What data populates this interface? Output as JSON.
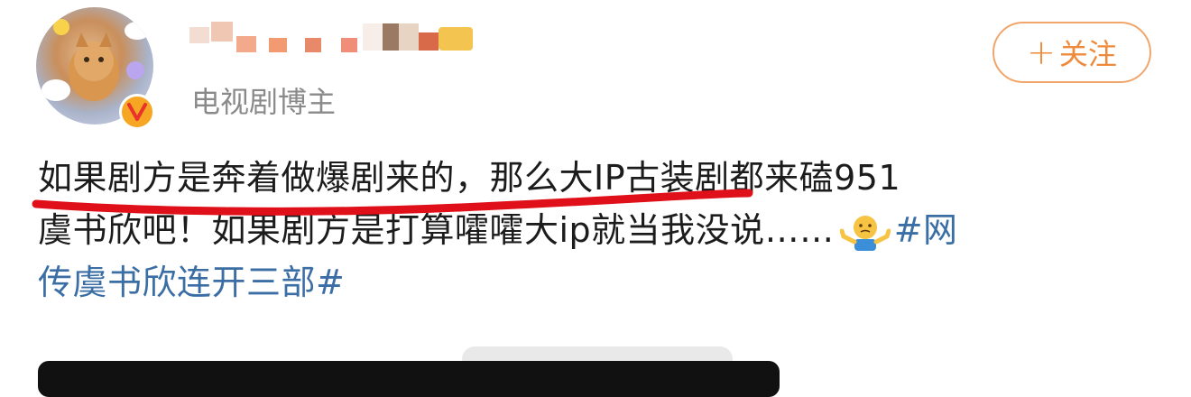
{
  "profile": {
    "username_redacted": true,
    "subtitle": "电视剧博主"
  },
  "follow_button": {
    "plus": "+",
    "label": "关注"
  },
  "post": {
    "line1": "如果剧方是奔着做爆剧来的，那么大IP古装剧都来磕951",
    "line2_text": "虞书欣吧！如果剧方是打算嚯嚯大ip就当我没说……",
    "line2_hashtag": "#网",
    "line3_hashtag": "传虞书欣连开三部#"
  },
  "colors": {
    "accent": "#ee8a3b",
    "hashtag": "#3b6ea5",
    "underline": "#e0101a",
    "badge": "#f6a623"
  },
  "icons": {
    "verified": "verified-v-icon",
    "emoji": "shrug-emoji-icon"
  }
}
